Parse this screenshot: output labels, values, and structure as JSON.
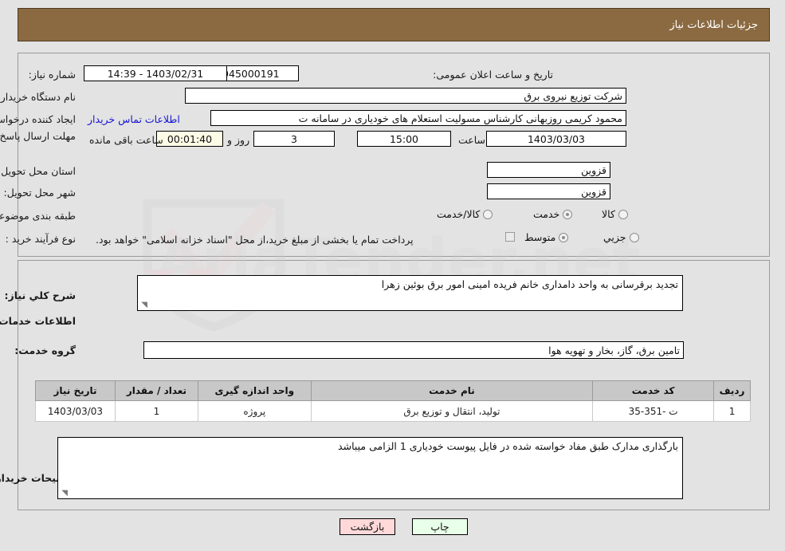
{
  "header": {
    "title": "جزئیات اطلاعات نیاز"
  },
  "top_form": {
    "need_number_label": "شماره نیاز:",
    "need_number_value": "1103000045000191",
    "announce_datetime_label": "تاریخ و ساعت اعلان عمومی:",
    "announce_datetime_value": "1403/02/31 - 14:39",
    "buyer_org_label": "نام دستگاه خریدار:",
    "buyer_org_value": "شرکت توزیع نیروی برق",
    "requester_label": "ایجاد کننده درخواست:",
    "requester_value": "محمود کریمی روزبهانی کارشناس  مسولیت استعلام های خودیاری در سامانه ت",
    "buyer_contact_link": "اطلاعات تماس خریدار",
    "deadline_label": "مهلت ارسال پاسخ: تا تاریخ:",
    "deadline_date": "1403/03/03",
    "hour_label": "ساعت",
    "hour_value": "15:00",
    "days_value": "3",
    "days_label": "روز و",
    "countdown_value": "00:01:40",
    "remaining_label": "ساعت باقی مانده",
    "province_label": "استان محل تحویل:",
    "province_value": "قزوین",
    "city_label": "شهر محل تحویل:",
    "city_value": "قزوین",
    "category_label": "طبقه بندی موضوعی:",
    "category_options": [
      {
        "label": "کالا",
        "selected": false
      },
      {
        "label": "خدمت",
        "selected": true
      },
      {
        "label": "کالا/خدمت",
        "selected": false
      }
    ],
    "process_label": "نوع فرآیند خرید :",
    "process_options": [
      {
        "label": "جزیي",
        "selected": false
      },
      {
        "label": "متوسط",
        "selected": true
      }
    ],
    "treasury_checkbox_checked": false,
    "treasury_text": "پرداخت تمام یا بخشی از مبلغ خرید،از محل \"اسناد خزانه اسلامی\" خواهد بود."
  },
  "middle": {
    "general_desc_label": "شرح کلي نیاز:",
    "general_desc_value": "تجدید برقرسانی به واحد دامداری خانم فریده امینی  امور برق بوئین زهرا",
    "services_section_title": "اطلاعات خدمات مورد نیاز",
    "service_group_label": "گروه خدمت:",
    "service_group_value": "تامین برق، گاز، بخار و تهویه هوا",
    "table": {
      "columns": [
        "ردیف",
        "کد خدمت",
        "نام خدمت",
        "واحد اندازه گیری",
        "تعداد / مقدار",
        "تاریخ نیاز"
      ],
      "rows": [
        {
          "row_no": "1",
          "service_code": "ت -351-35",
          "service_name": "تولید، انتقال و توزیع برق",
          "unit": "پروژه",
          "quantity": "1",
          "need_date": "1403/03/03"
        }
      ]
    },
    "buyer_notes_label": "توضیحات خریدار:",
    "buyer_notes_value": "بارگذاری مدارک طبق  مفاد خواسته شده در فایل پیوست خودیاری 1 الزامی میباشد"
  },
  "footer": {
    "back_button": "بازگشت",
    "print_button": "چاپ"
  },
  "watermark": {
    "text": "AriaTender.net",
    "shield_color": "#c9c9c9",
    "check_color": "#f3c9cf"
  },
  "colors": {
    "titlebar_bg": "#8b6a41",
    "page_bg": "#e3e3e3",
    "link": "#1414d2",
    "table_header_bg": "#c8c8c8",
    "back_btn_bg": "#ffd9d9",
    "print_btn_bg": "#e8ffe8",
    "countdown_bg": "#fbfbe6"
  }
}
